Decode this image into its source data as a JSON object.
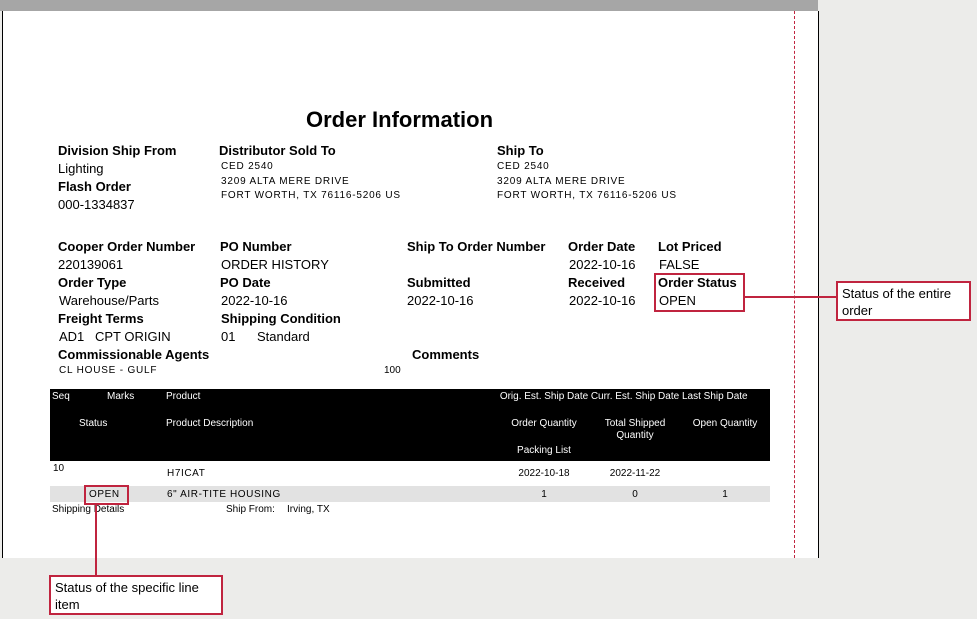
{
  "title": "Order Information",
  "header": {
    "division_ship_from_label": "Division Ship From",
    "division_ship_from_value": "Lighting",
    "flash_order_label": "Flash Order",
    "flash_order_value": "000-1334837",
    "distributor_sold_to_label": "Distributor Sold To",
    "distributor_sold_to_lines": [
      "CED 2540",
      "3209 ALTA MERE DRIVE",
      "FORT WORTH, TX 76116-5206 US"
    ],
    "ship_to_label": "Ship To",
    "ship_to_lines": [
      "CED 2540",
      "3209 ALTA MERE DRIVE",
      "FORT WORTH, TX 76116-5206 US"
    ]
  },
  "details": {
    "cooper_order_number_label": "Cooper Order Number",
    "cooper_order_number": "220139061",
    "po_number_label": "PO Number",
    "po_number": "ORDER HISTORY",
    "ship_to_order_number_label": "Ship To Order Number",
    "order_date_label": "Order Date",
    "order_date": "2022-10-16",
    "lot_priced_label": "Lot Priced",
    "lot_priced": "FALSE",
    "order_type_label": "Order Type",
    "order_type": "Warehouse/Parts",
    "po_date_label": "PO Date",
    "po_date": "2022-10-16",
    "submitted_label": "Submitted",
    "submitted": "2022-10-16",
    "received_label": "Received",
    "received": "2022-10-16",
    "order_status_label": "Order Status",
    "order_status": "OPEN",
    "freight_terms_label": "Freight Terms",
    "freight_terms_code": "AD1",
    "freight_terms": "CPT ORIGIN",
    "shipping_condition_label": "Shipping Condition",
    "shipping_condition_code": "01",
    "shipping_condition": "Standard",
    "commissionable_agents_label": "Commissionable Agents",
    "agent_name": "CL HOUSE - GULF",
    "agent_pct": "100",
    "comments_label": "Comments"
  },
  "table": {
    "headers": {
      "seq": "Seq",
      "marks": "Marks",
      "product": "Product",
      "orig_est_ship_date": "Orig. Est. Ship Date",
      "curr_est_ship_date": "Curr. Est. Ship Date",
      "last_ship_date": "Last Ship Date",
      "status": "Status",
      "product_description": "Product Description",
      "order_quantity": "Order Quantity",
      "total_shipped_quantity": "Total Shipped Quantity",
      "open_quantity": "Open Quantity",
      "packing_list": "Packing List"
    },
    "line": {
      "seq": "10",
      "product": "H7ICAT",
      "orig_est_ship_date": "2022-10-18",
      "curr_est_ship_date": "2022-11-22",
      "status": "OPEN",
      "product_description": "6\" AIR-TITE HOUSING",
      "order_quantity": "1",
      "total_shipped_quantity": "0",
      "open_quantity": "1",
      "shipping_details_label": "Shipping Details",
      "ship_from_label": "Ship From:",
      "ship_from": "Irving, TX"
    }
  },
  "annotations": {
    "order_status_note": "Status of the entire order",
    "line_status_note": "Status of the specific line item",
    "accent_color": "#c0243f"
  }
}
